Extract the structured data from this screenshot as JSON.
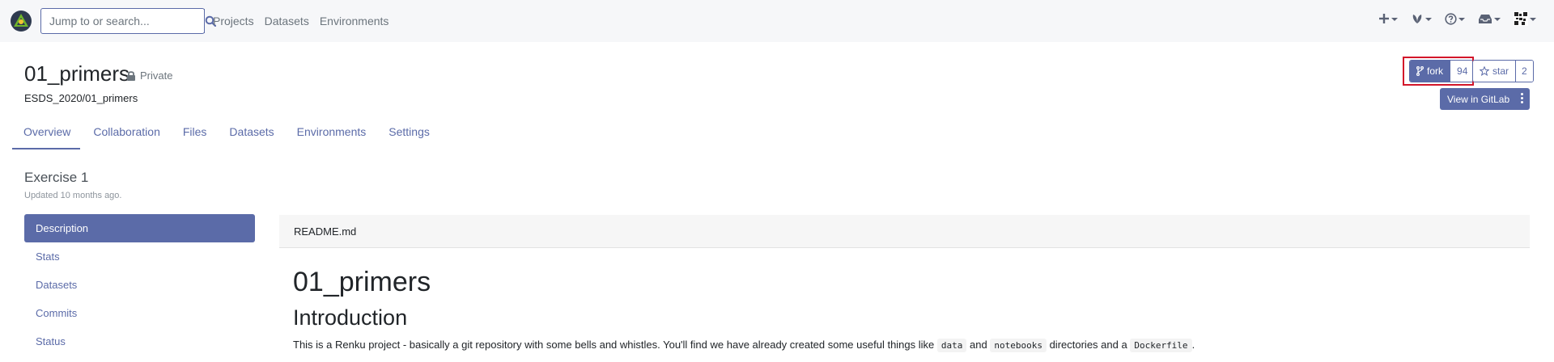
{
  "navbar": {
    "search_placeholder": "Jump to or search...",
    "links": [
      "Projects",
      "Datasets",
      "Environments"
    ]
  },
  "project": {
    "title": "01_primers",
    "visibility": "Private",
    "path": "ESDS_2020/01_primers",
    "fork_label": "fork",
    "fork_count": "94",
    "star_label": "star",
    "star_count": "2",
    "gitlab_label": "View in GitLab"
  },
  "tabs": [
    "Overview",
    "Collaboration",
    "Files",
    "Datasets",
    "Environments",
    "Settings"
  ],
  "overview": {
    "heading": "Exercise 1",
    "updated": "Updated 10 months ago.",
    "sidenav": [
      "Description",
      "Stats",
      "Datasets",
      "Commits",
      "Status"
    ]
  },
  "readme": {
    "filename": "README.md",
    "h1": "01_primers",
    "h2": "Introduction",
    "para_1": "This is a Renku project - basically a git repository with some bells and whistles. You'll find we have already created some useful things like",
    "code_1": "data",
    "para_2": "and",
    "code_2": "notebooks",
    "para_3": "directories and a",
    "code_3": "Dockerfile",
    "para_4": "."
  },
  "colors": {
    "accent": "#5b6ba8",
    "highlight": "#d3162a",
    "navbar_bg": "#f6f7f9"
  },
  "icons": [
    "renku-logo-icon",
    "search-icon",
    "plus-icon",
    "leaf-icon",
    "help-icon",
    "inbox-icon",
    "avatar-icon",
    "lock-icon",
    "fork-icon",
    "star-icon",
    "kebab-icon"
  ]
}
